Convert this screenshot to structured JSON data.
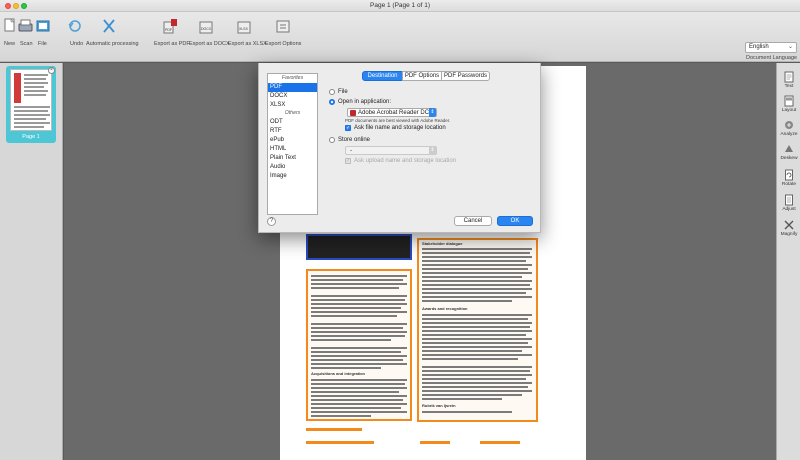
{
  "window": {
    "title": "Page 1 (Page 1 of 1)"
  },
  "toolbar": {
    "new": "New",
    "scan": "Scan",
    "file": "File",
    "undo": "Undo",
    "auto": "Automatic processing",
    "export_pdf": "Export as PDF",
    "export_docx": "Export as DOCX",
    "export_xlsx": "Export as XLSX",
    "export_options": "Export Options",
    "language_value": "English",
    "language_label": "Document Language"
  },
  "thumbnails": [
    {
      "label": "Page 1"
    }
  ],
  "sidebar_right": {
    "text": "Text",
    "layout": "Layout",
    "analyze": "Analyze",
    "deskew": "Deskew",
    "rotate": "Rotate",
    "adjust": "Adjust",
    "magnify": "Magnify"
  },
  "dialog": {
    "tabs": [
      "Destination",
      "PDF Options",
      "PDF Passwords"
    ],
    "format_list": {
      "favorites_header": "Favorites",
      "favorites": [
        "PDF",
        "DOCX",
        "XLSX"
      ],
      "others_header": "Others",
      "others": [
        "ODT",
        "RTF",
        "ePub",
        "HTML",
        "Plain Text",
        "Audio",
        "Image"
      ]
    },
    "file_label": "File",
    "open_in_app_label": "Open in application:",
    "app_value": "Adobe Acrobat Reader DC",
    "app_note": "PDF documents are best viewed with Adobe Reader.",
    "ask_file_name_label": "Ask file name and storage location",
    "store_online_label": "Store online",
    "store_online_value": "-",
    "ask_upload_label": "Ask upload name and storage location",
    "cancel": "Cancel",
    "ok": "OK",
    "help": "?"
  },
  "page_content": {
    "left_heading": "Acquisitions and integration",
    "right_heading1": "Stakeholder dialogue",
    "right_heading2": "Awards and recognition",
    "right_heading3": "Rubrik van Ijsrein"
  },
  "colors": {
    "accent": "#2b85f0",
    "region": "#f28a1c",
    "selection": "#4dc7d6"
  }
}
